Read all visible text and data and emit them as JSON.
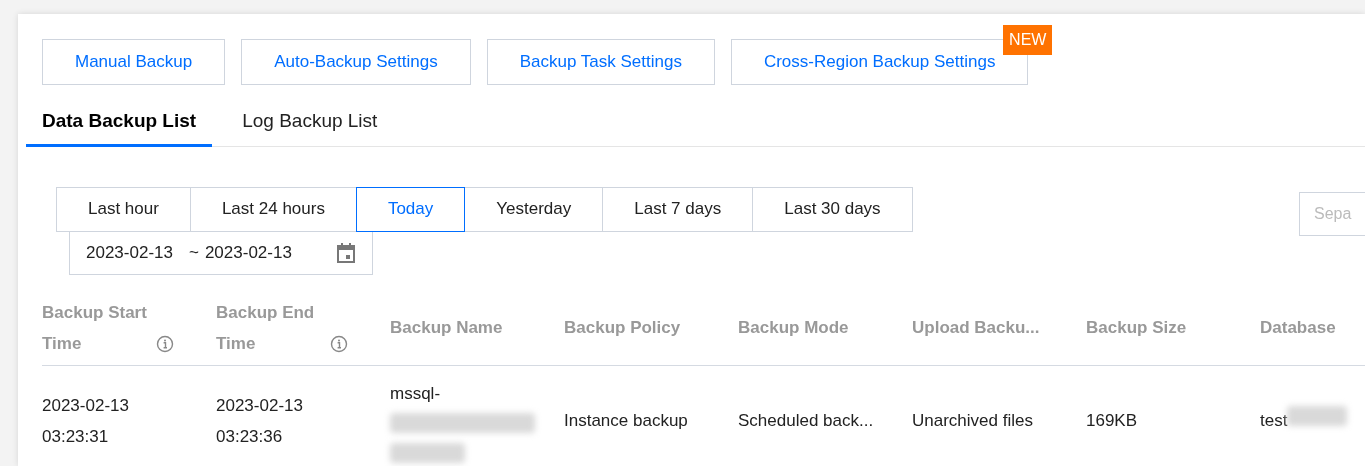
{
  "action_buttons": [
    {
      "label": "Manual Backup"
    },
    {
      "label": "Auto-Backup Settings"
    },
    {
      "label": "Backup Task Settings"
    },
    {
      "label": "Cross-Region Backup Settings",
      "badge": "NEW"
    }
  ],
  "tabs": [
    {
      "label": "Data Backup List",
      "selected": true
    },
    {
      "label": "Log Backup List",
      "selected": false
    }
  ],
  "time_ranges": [
    {
      "label": "Last hour",
      "selected": false
    },
    {
      "label": "Last 24 hours",
      "selected": false
    },
    {
      "label": "Today",
      "selected": true
    },
    {
      "label": "Yesterday",
      "selected": false
    },
    {
      "label": "Last 7 days",
      "selected": false
    },
    {
      "label": "Last 30 days",
      "selected": false
    }
  ],
  "date_range": {
    "start": "2023-02-13",
    "separator": "~",
    "end": "2023-02-13"
  },
  "search": {
    "placeholder": "Sepa"
  },
  "table": {
    "columns": [
      {
        "label": "Backup Start Time",
        "info": true
      },
      {
        "label": "Backup End Time",
        "info": true
      },
      {
        "label": "Backup Name"
      },
      {
        "label": "Backup Policy"
      },
      {
        "label": "Backup Mode"
      },
      {
        "label": "Upload Backu..."
      },
      {
        "label": "Backup Size"
      },
      {
        "label": "Database"
      }
    ],
    "rows": [
      {
        "cells": [
          {
            "kind": "text",
            "lines": [
              "2023-02-13",
              "03:23:31"
            ]
          },
          {
            "kind": "text",
            "lines": [
              "2023-02-13",
              "03:23:36"
            ]
          },
          {
            "kind": "redacted_below",
            "lines": [
              "mssql-"
            ]
          },
          {
            "kind": "text",
            "lines": [
              "Instance backup"
            ]
          },
          {
            "kind": "text",
            "lines": [
              "Scheduled back..."
            ]
          },
          {
            "kind": "text",
            "lines": [
              "Unarchived files"
            ]
          },
          {
            "kind": "text",
            "lines": [
              "169KB"
            ]
          },
          {
            "kind": "redacted_inline",
            "lines": [
              "test"
            ]
          }
        ]
      }
    ]
  }
}
